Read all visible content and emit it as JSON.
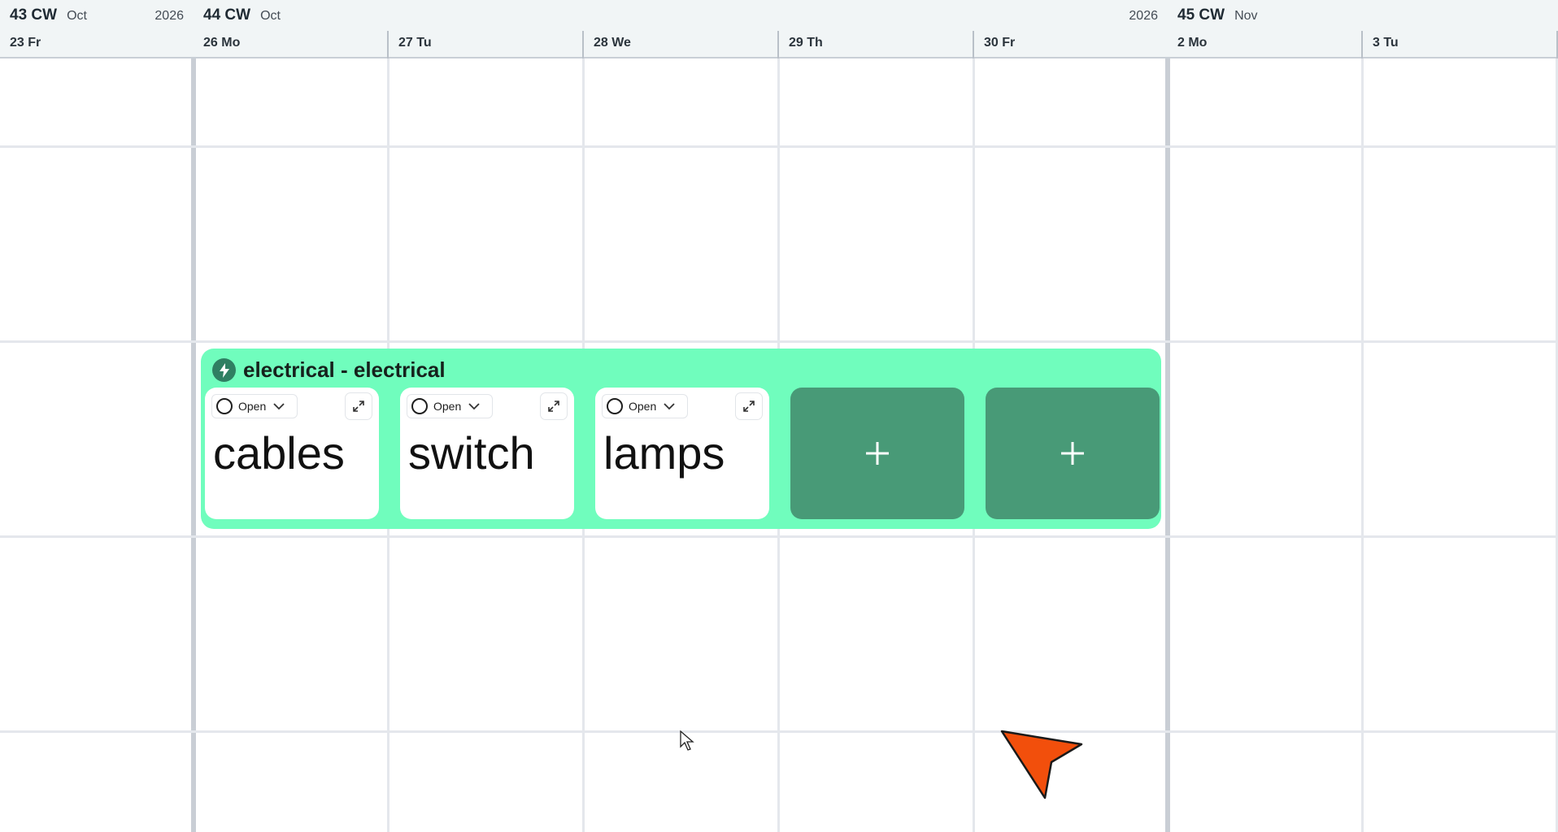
{
  "weeks": [
    {
      "cw": "43 CW",
      "month": "Oct",
      "year": "2026"
    },
    {
      "cw": "44 CW",
      "month": "Oct",
      "year": "2026"
    },
    {
      "cw": "45 CW",
      "month": "Nov",
      "year": ""
    }
  ],
  "days": [
    "23 Fr",
    "26 Mo",
    "27 Tu",
    "28 We",
    "29 Th",
    "30 Fr",
    "2 Mo",
    "3 Tu"
  ],
  "group": {
    "title": "electrical - electrical",
    "color": "#70fdbd",
    "icon": "lightning-bolt-icon"
  },
  "tasks": [
    {
      "title": "cables",
      "status": "Open"
    },
    {
      "title": "switch",
      "status": "Open"
    },
    {
      "title": "lamps",
      "status": "Open"
    }
  ],
  "add_slots": [
    {
      "label": "+"
    },
    {
      "label": "+"
    }
  ],
  "colors": {
    "header_bg": "#f1f5f6",
    "add_button": "#489a77",
    "cursor": "#f24f0c"
  }
}
